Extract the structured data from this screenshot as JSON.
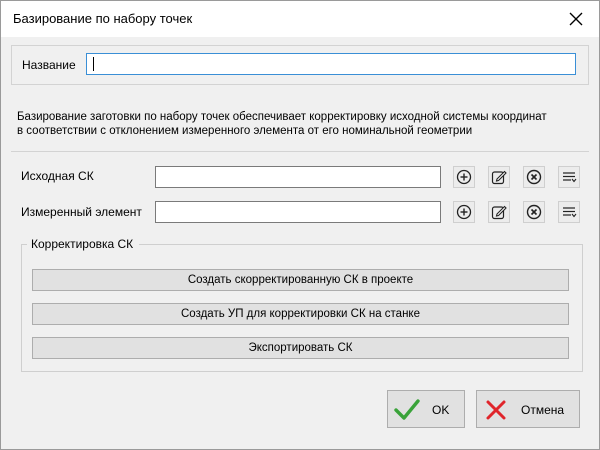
{
  "window": {
    "title": "Базирование по набору точек"
  },
  "icons": {
    "close": "close-icon",
    "add": "plus-circle-icon",
    "edit": "edit-pencil-icon",
    "remove": "x-circle-icon",
    "list": "list-icon",
    "ok": "green-check-icon",
    "cancel": "red-cross-icon"
  },
  "name_field": {
    "label": "Название",
    "value": ""
  },
  "description": {
    "line1": "Базирование заготовки по набору точек обеспечивает корректировку исходной системы координат",
    "line2": "в соответствии с отклонением измеренного элемента от его номинальной геометрии"
  },
  "source_cs": {
    "label": "Исходная СК",
    "value": ""
  },
  "measured_element": {
    "label": "Измеренный элемент",
    "value": ""
  },
  "correction": {
    "title": "Корректировка СК",
    "create_cs": "Создать скорректированную СК в проекте",
    "create_program": "Создать УП для корректировки СК на станке",
    "export_cs": "Экспортировать СК"
  },
  "buttons": {
    "ok": "OK",
    "cancel": "Отмена"
  },
  "colors": {
    "accent": "#3a8fd6",
    "ok_check": "#3aa33a",
    "cancel_cross": "#e0252b"
  }
}
